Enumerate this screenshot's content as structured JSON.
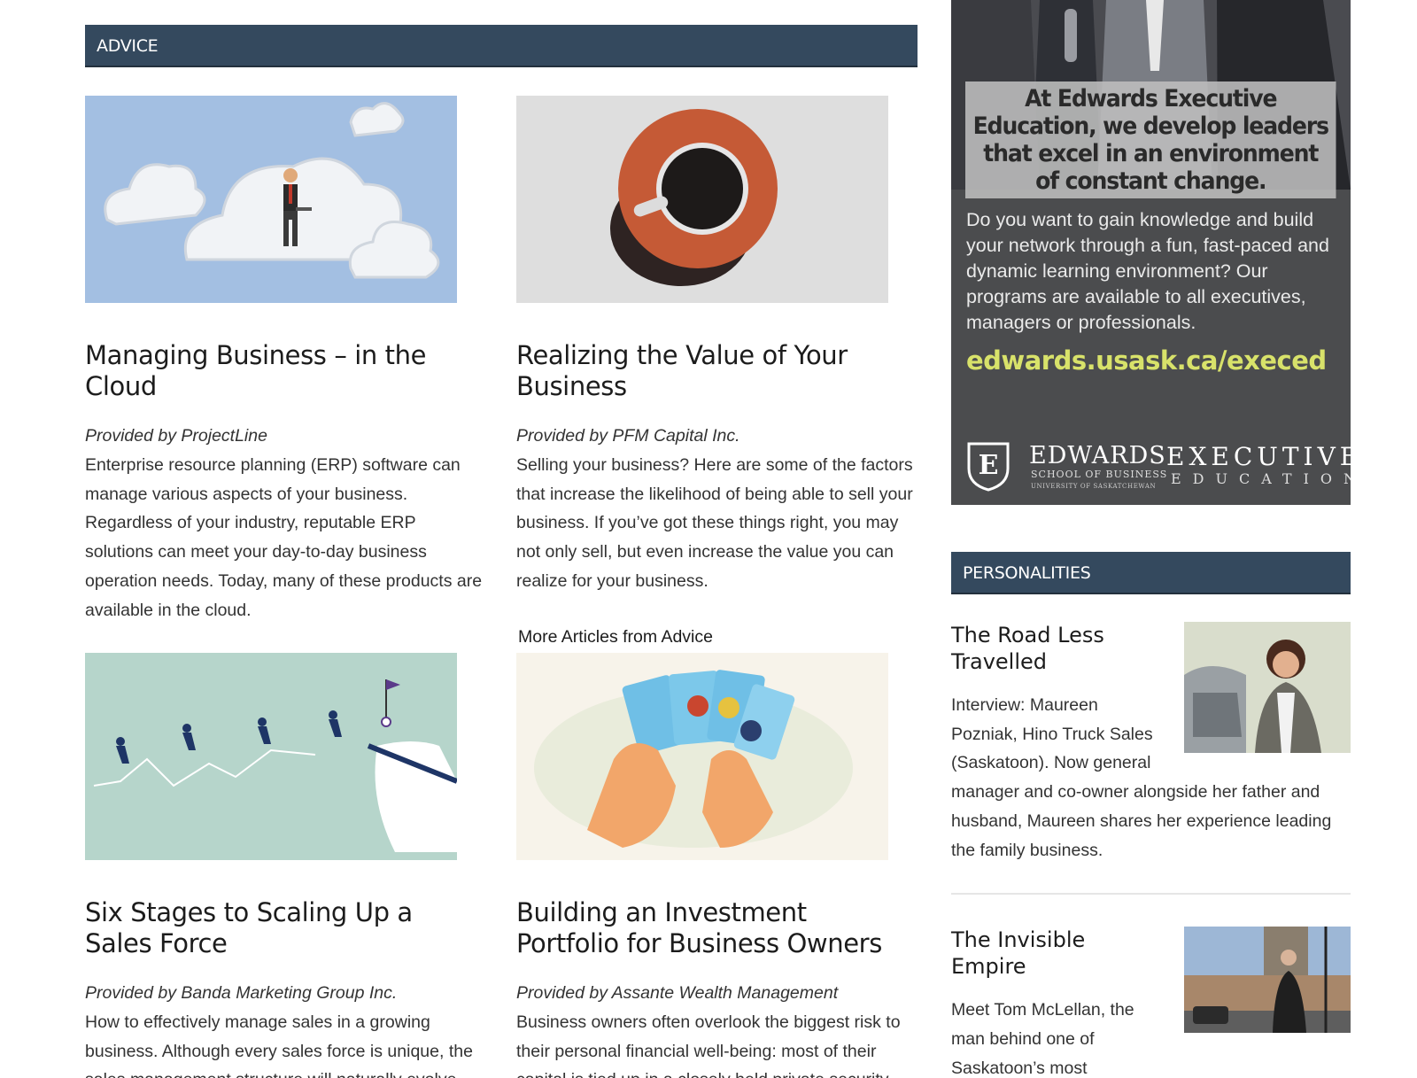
{
  "advice": {
    "header": "ADVICE",
    "more_label": "More Articles from Advice",
    "articles": [
      {
        "title": "Managing Business – in the Cloud",
        "provider": "Provided by ProjectLine",
        "excerpt": "Enterprise resource planning (ERP) software can manage various aspects of your business. Regardless of your industry, reputable ERP solutions can meet your day-to-day business operation needs. Today, many of these products are available in the cloud."
      },
      {
        "title": "Realizing the Value of Your Business",
        "provider": "Provided by PFM Capital Inc.",
        "excerpt": "Selling your business? Here are some of the factors that increase the likelihood of being able to sell your business. If you’ve got these things right, you may not only sell, but even increase the value you can realize for your business."
      },
      {
        "title": "Six Stages to Scaling Up a Sales Force",
        "provider": "Provided by Banda Marketing Group Inc.",
        "excerpt": "How to effectively manage sales in a growing business. Although every sales force is unique, the sales management structure will naturally evolve"
      },
      {
        "title": "Building an Investment Portfolio for Business Owners",
        "provider": "Provided by Assante Wealth Management",
        "excerpt": "Business owners often overlook the biggest risk to their personal financial well-being: most of their capital is tied up in a closely held private security"
      }
    ]
  },
  "ad": {
    "headline": "At Edwards Executive Education, we develop leaders that excel in an environment of constant change.",
    "body": "Do you want to gain knowledge and build your network through a  fun, fast-paced and dynamic learning environment? Our programs are available to all executives, managers or professionals.",
    "url": "edwards.usask.ca/execed",
    "logo_name": "EDWARDS",
    "logo_sub": "SCHOOL OF BUSINESS",
    "logo_sub2": "UNIVERSITY OF SASKATCHEWAN",
    "logo_exec1": "EXECUTIVE",
    "logo_exec2": "EDUCATION"
  },
  "personalities": {
    "header": "PERSONALITIES",
    "items": [
      {
        "title": "The Road Less Travelled",
        "excerpt": "Interview: Maureen Pozniak, Hino Truck Sales (Saskatoon). Now general manager and co-owner alongside her father and husband, Maureen shares her experience leading the family business."
      },
      {
        "title": "The Invisible Empire",
        "excerpt": "Meet Tom McLellan, the man behind one of Saskatoon’s most"
      }
    ]
  },
  "colors": {
    "header_bg": "#34495e",
    "ad_bg": "#4b4c4e",
    "ad_url": "#d8e26a"
  }
}
